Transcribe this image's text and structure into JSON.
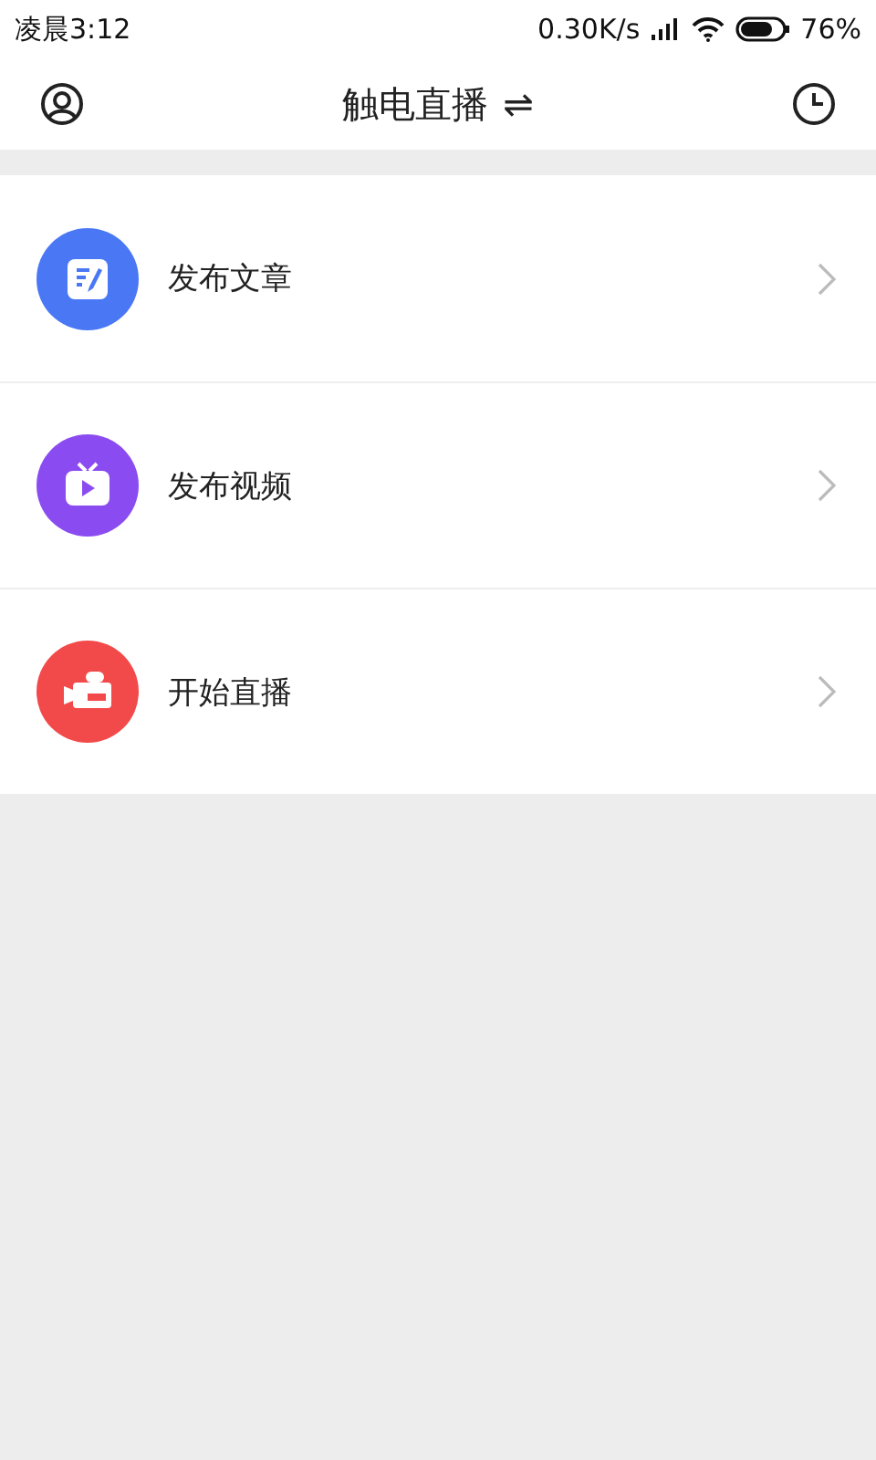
{
  "status_bar": {
    "time": "凌晨3:12",
    "speed": "0.30K/s",
    "battery": "76%"
  },
  "nav_bar": {
    "title": "触电直播",
    "switch_glyph": "⇌"
  },
  "items": [
    {
      "kind": "article",
      "label": "发布文章",
      "color": "#4a78f5"
    },
    {
      "kind": "video",
      "label": "发布视频",
      "color": "#8a4cf0"
    },
    {
      "kind": "live",
      "label": "开始直播",
      "color": "#f24a4a"
    }
  ]
}
